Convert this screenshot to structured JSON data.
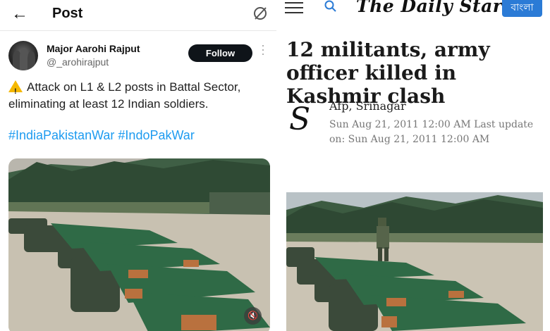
{
  "post": {
    "header_title": "Post",
    "author_name": "Major Aarohi Rajput",
    "author_handle": "@_arohirajput",
    "follow_label": "Follow",
    "text": "Attack on L1 & L2 posts in Battal Sector, eliminating at least 12 Indian soldiers.",
    "hashtags": [
      "#IndiaPakistanWar",
      "#IndoPakWar"
    ],
    "warning_icon": "warning-icon",
    "video_icon": "mute-icon"
  },
  "article": {
    "masthead": "The Daily Star",
    "language_button": "বাংলা",
    "headline": "12 militants, army officer killed in Kashmir clash",
    "byline": "Afp, Srinagar",
    "dateline": "Sun Aug 21, 2011 12:00 AM Last update on: Sun Aug 21, 2011 12:00 AM"
  },
  "colors": {
    "follow_button": "#0f1419",
    "hashtag": "#1d9bf0",
    "bangla_button": "#2b7bd6"
  }
}
